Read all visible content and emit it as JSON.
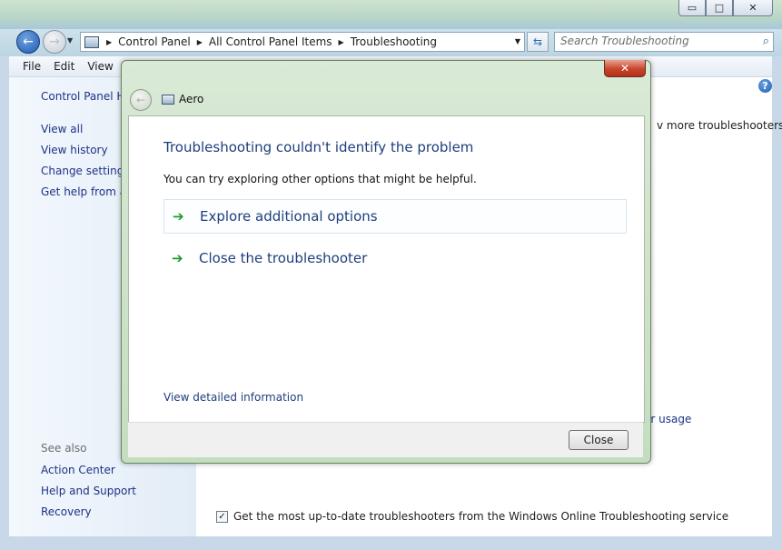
{
  "window": {
    "controls": {
      "minimize": "▭",
      "restore": "□",
      "close": "✕"
    }
  },
  "address": {
    "crumbs": [
      "Control Panel",
      "All Control Panel Items",
      "Troubleshooting"
    ],
    "search_placeholder": "Search Troubleshooting"
  },
  "menu": [
    "File",
    "Edit",
    "View"
  ],
  "sidebar": {
    "home": "Control Panel Ho",
    "links": [
      "View all",
      "View history",
      "Change settings",
      "Get help from a f"
    ],
    "see_also_label": "See also",
    "see_also": [
      "Action Center",
      "Help and Support",
      "Recovery"
    ]
  },
  "main": {
    "more_troubleshooters": "v more troubleshooters,",
    "power_usage": "er usage",
    "update_checkbox_label": "Get the most up-to-date troubleshooters from the Windows Online Troubleshooting service",
    "update_checked": true
  },
  "dialog": {
    "title": "Aero",
    "heading": "Troubleshooting couldn't identify the problem",
    "message": "You can try exploring other options that might be helpful.",
    "options": [
      "Explore additional options",
      "Close the troubleshooter"
    ],
    "detail_link": "View detailed information",
    "close_button": "Close"
  },
  "colors": {
    "link": "#1e3287",
    "heading": "#1e3e7c",
    "arrow": "#1c9a2c",
    "dialog_frame": "#c4ddbf"
  },
  "icons": [
    "back-arrow-icon",
    "forward-arrow-icon",
    "control-panel-icon",
    "refresh-icon",
    "search-icon",
    "help-icon",
    "green-arrow-icon",
    "close-x-icon"
  ]
}
